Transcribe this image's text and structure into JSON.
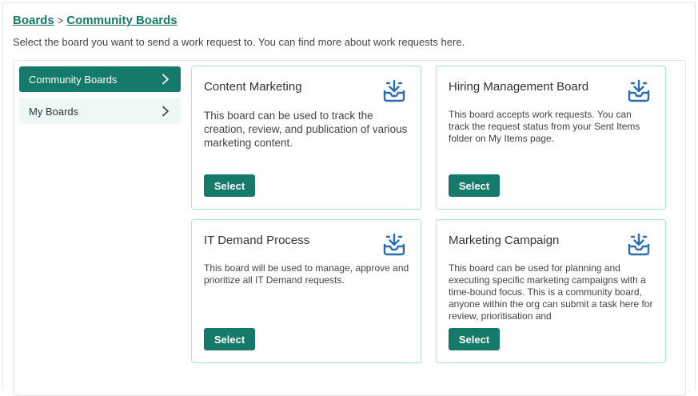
{
  "breadcrumb": {
    "root": "Boards",
    "separator": ">",
    "current": "Community Boards"
  },
  "intro_text": "Select the board you want to send a work request to. You can find more about work requests here.",
  "sidebar": {
    "items": [
      {
        "label": "Community Boards",
        "active": true
      },
      {
        "label": "My Boards",
        "active": false
      }
    ]
  },
  "cards": [
    {
      "title": "Content Marketing",
      "description": "This board can be used to track the creation, review, and publication of various marketing content.",
      "button": "Select",
      "icon": "inbox-download-icon"
    },
    {
      "title": "Hiring Management Board",
      "description": "This board accepts work requests. You can track the request status from your Sent Items folder on My Items page.",
      "button": "Select",
      "icon": "inbox-download-icon"
    },
    {
      "title": "IT Demand Process",
      "description": "This board will be used to manage, approve and prioritize all IT Demand requests.",
      "button": "Select",
      "icon": "inbox-download-icon"
    },
    {
      "title": "Marketing Campaign",
      "description": "This board can be used for planning and executing specific marketing campaigns with a time-bound focus. This is a community board, anyone within the org can submit a task here for review, prioritisation and",
      "button": "Select",
      "icon": "inbox-download-icon"
    }
  ],
  "colors": {
    "accent": "#167a6b",
    "card_border": "#a5e3d6",
    "icon": "#2b6cb0"
  }
}
